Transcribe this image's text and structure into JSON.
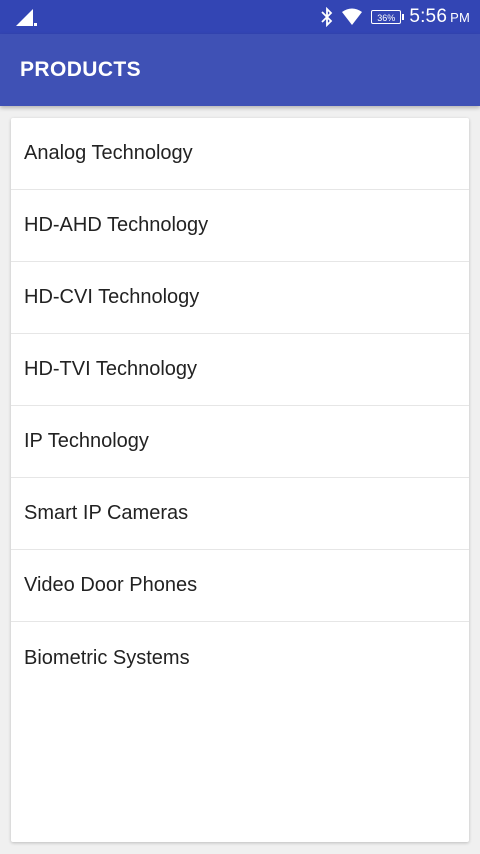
{
  "status_bar": {
    "time": "5:56",
    "ampm": "PM",
    "battery": "36%",
    "icons": [
      "signal-icon",
      "bluetooth-icon",
      "wifi-icon",
      "battery-icon"
    ]
  },
  "app_bar": {
    "title": "PRODUCTS",
    "color": "#3f51b5"
  },
  "products": {
    "items": [
      {
        "label": "Analog Technology"
      },
      {
        "label": "HD-AHD Technology"
      },
      {
        "label": "HD-CVI Technology"
      },
      {
        "label": "HD-TVI Technology"
      },
      {
        "label": "IP Technology"
      },
      {
        "label": "Smart IP Cameras"
      },
      {
        "label": "Video Door Phones"
      },
      {
        "label": "Biometric Systems"
      }
    ]
  }
}
